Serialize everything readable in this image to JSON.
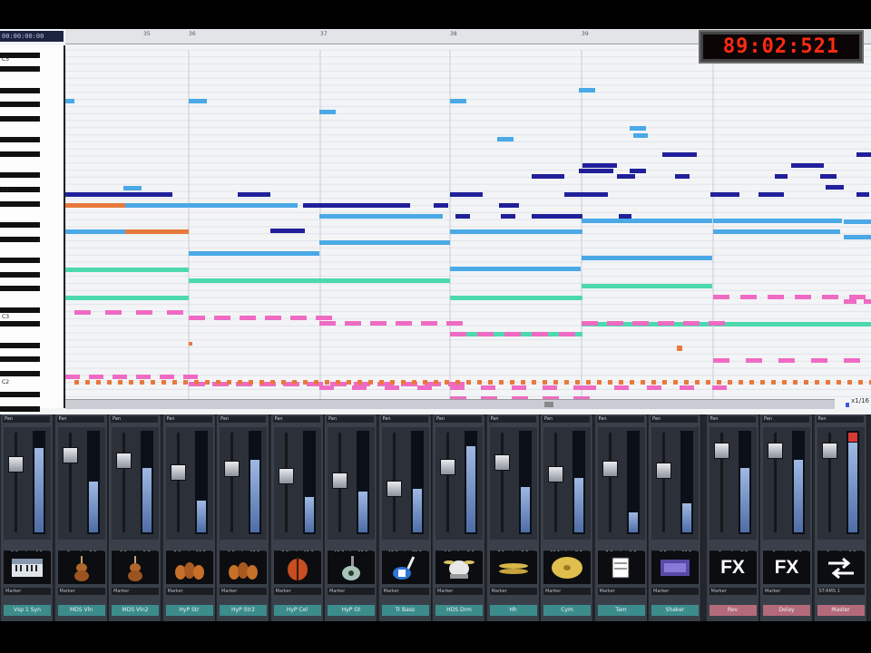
{
  "window": {
    "position_readout": "00:00:00:00",
    "timecode": "89:02:521",
    "zoom_label": "x1/16"
  },
  "ruler": {
    "bar_labels": [
      "35",
      "36",
      "37",
      "38",
      "39"
    ]
  },
  "keyboard": {
    "octave_labels": [
      "C5",
      "C4",
      "C3",
      "C2"
    ]
  },
  "mixer": {
    "strips": [
      {
        "name": "Vsp 1 Syn",
        "icon": "keyboard-icon",
        "pan_label": "Pan",
        "vol_label": "Vol",
        "val_left": "0.0",
        "val_right": "-4.6",
        "marker": "Marker",
        "fader": 0.72,
        "level": 0.86,
        "kind": "inst"
      },
      {
        "name": "MDS Vln",
        "icon": "violin-icon",
        "pan_label": "Pan",
        "vol_label": "Vol",
        "val_left": "0",
        "val_right": "-3.9",
        "marker": "Marker",
        "fader": 0.83,
        "level": 0.52,
        "kind": "inst"
      },
      {
        "name": "MDS Vln2",
        "icon": "violin-icon",
        "pan_label": "Pan",
        "vol_label": "Vol",
        "val_left": "-8.0",
        "val_right": "-5.8",
        "marker": "Marker",
        "fader": 0.76,
        "level": 0.66,
        "kind": "inst"
      },
      {
        "name": "HyP Str",
        "icon": "strings-icon",
        "pan_label": "Pan",
        "vol_label": "Vol",
        "val_left": "-7.0",
        "val_right": "-13.5",
        "marker": "Marker",
        "fader": 0.62,
        "level": 0.32,
        "kind": "inst"
      },
      {
        "name": "HyP Str2",
        "icon": "strings-icon",
        "pan_label": "Pan",
        "vol_label": "Vol",
        "val_left": "-9.9",
        "val_right": "-13.5",
        "marker": "Marker",
        "fader": 0.66,
        "level": 0.74,
        "kind": "inst"
      },
      {
        "name": "HyP Cel",
        "icon": "cello-icon",
        "pan_label": "Pan",
        "vol_label": "Vol",
        "val_left": "-9.9",
        "val_right": "-11.0",
        "marker": "Marker",
        "fader": 0.58,
        "level": 0.36,
        "kind": "inst"
      },
      {
        "name": "HyP Gt",
        "icon": "guitar-icon",
        "pan_label": "Pan",
        "vol_label": "Vol",
        "val_left": "-10.0",
        "val_right": "-13.5",
        "marker": "Marker",
        "fader": 0.52,
        "level": 0.42,
        "kind": "inst"
      },
      {
        "name": "Tr Bass",
        "icon": "bass-icon",
        "pan_label": "Pan",
        "vol_label": "Vol",
        "val_left": "-18.0",
        "val_right": "-22.3",
        "marker": "Marker",
        "fader": 0.42,
        "level": 0.44,
        "kind": "inst"
      },
      {
        "name": "HDS Drm",
        "icon": "drums-icon",
        "pan_label": "Pan",
        "vol_label": "Vol",
        "val_left": "-4.6",
        "val_right": "-5.0",
        "marker": "Marker",
        "fader": 0.68,
        "level": 0.88,
        "kind": "inst"
      },
      {
        "name": "Hh",
        "icon": "hihat-icon",
        "pan_label": "Pan",
        "vol_label": "Vol",
        "val_left": "-8.1",
        "val_right": "-8.6",
        "marker": "Marker",
        "fader": 0.74,
        "level": 0.46,
        "kind": "inst"
      },
      {
        "name": "Cym",
        "icon": "cymbal-icon",
        "pan_label": "Pan",
        "vol_label": "Vol",
        "val_left": "-11.1",
        "val_right": "-8.8",
        "marker": "Marker",
        "fader": 0.6,
        "level": 0.56,
        "kind": "inst"
      },
      {
        "name": "Tam",
        "icon": "tambourine-icon",
        "pan_label": "Pan",
        "vol_label": "Vol",
        "val_left": "-7.0",
        "val_right": "-9.7",
        "marker": "Marker",
        "fader": 0.66,
        "level": 0.2,
        "kind": "inst"
      },
      {
        "name": "Shaker",
        "icon": "synth-icon",
        "pan_label": "Pan",
        "vol_label": "Vol",
        "val_left": "-8.5",
        "val_right": "-11.5",
        "marker": "Marker",
        "fader": 0.64,
        "level": 0.3,
        "kind": "inst"
      },
      {
        "name": "Rev",
        "icon": "fx-icon",
        "pan_label": "Pan",
        "vol_label": "Vol",
        "val_left": "0",
        "val_right": "-9.0",
        "marker": "Marker",
        "fader": 0.88,
        "level": 0.66,
        "kind": "fx"
      },
      {
        "name": "Delay",
        "icon": "fx-icon",
        "pan_label": "Pan",
        "vol_label": "Vol",
        "val_left": "0",
        "val_right": "-9.0",
        "marker": "Marker",
        "fader": 0.88,
        "level": 0.74,
        "kind": "fx"
      },
      {
        "name": "Master",
        "icon": "output-icon",
        "pan_label": "Pan",
        "vol_label": "Vol",
        "val_left": "0",
        "val_right": "-0.3",
        "marker": "ST-RMS 1",
        "fader": 0.88,
        "level": 0.92,
        "kind": "out"
      }
    ]
  },
  "colors": {
    "lead": "#21209a",
    "harmony": "#4aa9e6",
    "counter": "#e8793c",
    "pad": "#4cd9ae",
    "bass": "#ef6bc3",
    "perc": "#3f58e0"
  }
}
